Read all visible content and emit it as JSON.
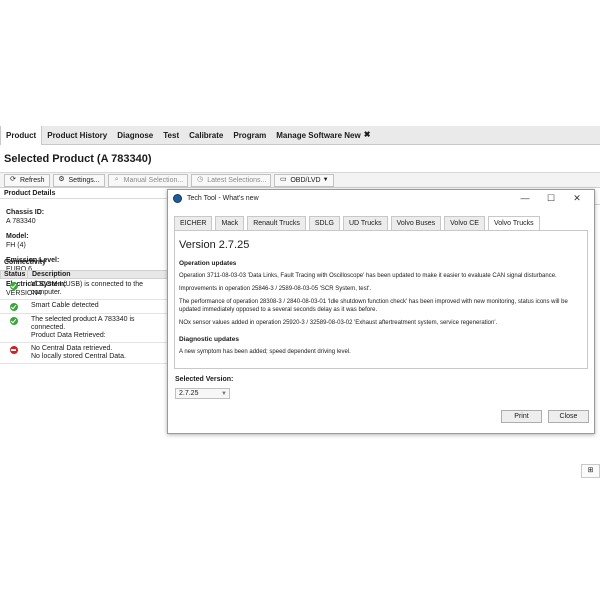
{
  "menu": {
    "items": [
      "Product",
      "Product History",
      "Diagnose",
      "Test",
      "Calibrate",
      "Program",
      "Manage Software New"
    ],
    "active": "Product"
  },
  "page": {
    "title": "Selected Product (A 783340)"
  },
  "toolbar": {
    "refresh": "Refresh",
    "settings": "Settings...",
    "manual": "Manual Selection...",
    "latest": "Latest Selections...",
    "obd": "OBD/LVD"
  },
  "details": {
    "header": "Product Details",
    "chassis_label": "Chassis ID:",
    "chassis_value": "A 783340",
    "model_label": "Model:",
    "model_value": "FH (4)",
    "emission_label": "Emission Level:",
    "emission_value": "EURO 6",
    "electrical_label": "Electrical System:",
    "electrical_value": "VERSION4"
  },
  "connectivity": {
    "header": "Connectivity",
    "col_status": "Status",
    "col_description": "Description",
    "rows": [
      {
        "status": "ok",
        "text": "VOCOM I (USB) is connected to the computer."
      },
      {
        "status": "ok",
        "text": "Smart Cable detected"
      },
      {
        "status": "ok",
        "text": "The selected product A 783340 is connected.\nProduct Data Retrieved:"
      },
      {
        "status": "error",
        "text": "No Central Data retrieved.\nNo locally stored Central Data."
      }
    ]
  },
  "dialog": {
    "title": "Tech Tool - What's new",
    "tabs": [
      "EICHER",
      "Mack",
      "Renault Trucks",
      "SDLG",
      "UD Trucks",
      "Volvo Buses",
      "Volvo CE",
      "Volvo Trucks"
    ],
    "active_tab": "Volvo Trucks",
    "version": "Version 2.7.25",
    "section1": "Operation updates",
    "para1": "Operation 3711-08-03-03 'Data Links, Fault Tracing with Oscilloscope' has been updated to make it easier to evaluate CAN signal disturbance.",
    "para2": "Improvements in operation 25846-3 / 2589-08-03-05 'SCR System, test'.",
    "para3": "The performance of operation 28308-3 / 2840-08-03-01 'Idle shutdown function check' has been improved with new monitoring, status icons will be updated immediately opposed to a several seconds delay as it was before.",
    "para4": "NOx sensor values added in operation 25920-3 / 32589-08-03-02 'Exhaust aftertreatment system, service regeneration'.",
    "section2": "Diagnostic updates",
    "para5": "A new symptom has been added; speed dependent driving level.",
    "selected_version_label": "Selected Version:",
    "selected_version": "2.7.25",
    "print": "Print",
    "close": "Close"
  }
}
